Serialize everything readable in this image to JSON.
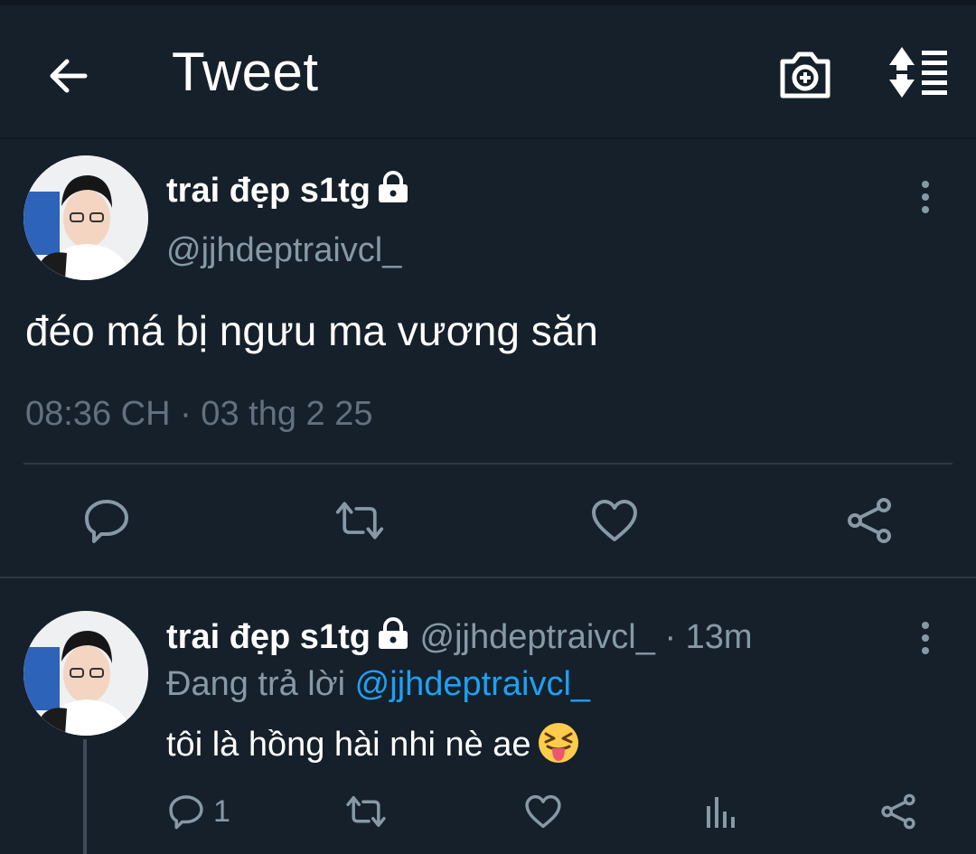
{
  "header": {
    "title": "Tweet",
    "back_icon": "arrow-left-icon",
    "camera_icon": "camera-add-icon",
    "sort_icon": "sort-icon"
  },
  "tweet": {
    "name": "trai đẹp s1tg",
    "handle": "@jjhdeptraivcl_",
    "text": "đéo má bị ngưu ma vương săn",
    "timestamp": "08:36 CH · 03 thg 2 25",
    "actions": [
      "reply-icon",
      "retweet-icon",
      "like-icon",
      "share-icon"
    ]
  },
  "reply": {
    "name": "trai đẹp s1tg",
    "handle": "@jjhdeptraivcl_",
    "dot": "·",
    "time": "13m",
    "replying_prefix": "Đang trả lời",
    "replying_to": "@jjhdeptraivcl_",
    "text": "tôi là hồng hài nhi nè ae",
    "emoji": "squinting-face-with-tongue",
    "reply_count": "1",
    "actions": [
      "reply-icon",
      "retweet-icon",
      "like-icon",
      "analytics-icon",
      "share-icon"
    ]
  },
  "colors": {
    "background": "#15202b",
    "secondary_text": "#8899a6",
    "link": "#1da1f2"
  }
}
